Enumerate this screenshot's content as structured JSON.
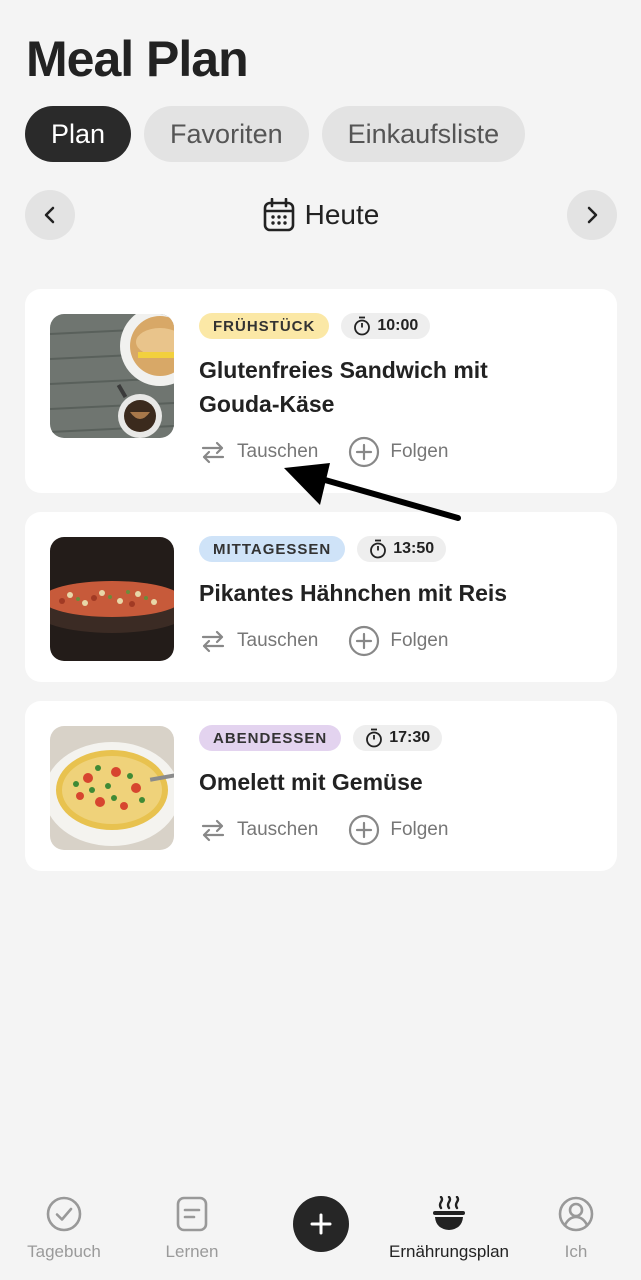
{
  "header": {
    "title": "Meal Plan"
  },
  "tabs": [
    {
      "label": "Plan"
    },
    {
      "label": "Favoriten"
    },
    {
      "label": "Einkaufsliste"
    }
  ],
  "date_nav": {
    "label": "Heute"
  },
  "meals": [
    {
      "badge": "FRÜHSTÜCK",
      "time": "10:00",
      "title_line1": "Glutenfreies Sandwich mit",
      "title_line2": "Gouda-Käse",
      "swap_label": "Tauschen",
      "follow_label": "Folgen",
      "badge_color": "#fbe8a6"
    },
    {
      "badge": "MITTAGESSEN",
      "time": "13:50",
      "title_line1": "Pikantes Hähnchen mit Reis",
      "swap_label": "Tauschen",
      "follow_label": "Folgen",
      "badge_color": "#cfe3f8"
    },
    {
      "badge": "ABENDESSEN",
      "time": "17:30",
      "title_line1": "Omelett mit Gemüse",
      "swap_label": "Tauschen",
      "follow_label": "Folgen",
      "badge_color": "#e3d3ef"
    }
  ],
  "bottom_nav": {
    "items": [
      {
        "label": "Tagebuch",
        "icon": "check-circle-icon"
      },
      {
        "label": "Lernen",
        "icon": "document-icon"
      },
      {
        "label": "",
        "icon": "plus-icon"
      },
      {
        "label": "Ernährungsplan",
        "icon": "bowl-icon",
        "active": true
      },
      {
        "label": "Ich",
        "icon": "user-icon"
      }
    ]
  },
  "colors": {
    "background": "#f4f4f4",
    "active_tab": "#2a2a2a",
    "inactive_tab": "#e3e3e3",
    "text_primary": "#222222",
    "text_secondary": "#777777"
  }
}
